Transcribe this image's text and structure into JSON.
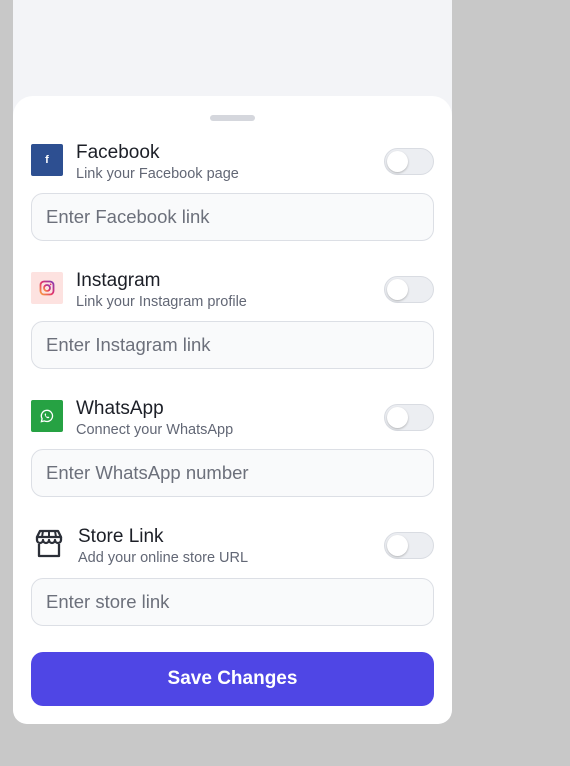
{
  "links": [
    {
      "key": "facebook",
      "title": "Facebook",
      "subtitle": "Link your Facebook page",
      "placeholder": "Enter Facebook link",
      "enabled": false,
      "icon": "facebook-icon",
      "icon_glyph": "f",
      "icon_color": "#2d4f91"
    },
    {
      "key": "instagram",
      "title": "Instagram",
      "subtitle": "Link your Instagram profile",
      "placeholder": "Enter Instagram link",
      "enabled": false,
      "icon": "instagram-icon",
      "icon_color": "#fde2e0"
    },
    {
      "key": "whatsapp",
      "title": "WhatsApp",
      "subtitle": "Connect your WhatsApp",
      "placeholder": "Enter WhatsApp number",
      "enabled": false,
      "icon": "whatsapp-icon",
      "icon_color": "#26a243"
    },
    {
      "key": "store",
      "title": "Store Link",
      "subtitle": "Add your online store URL",
      "placeholder": "Enter store link",
      "enabled": false,
      "icon": "store-icon"
    }
  ],
  "save_button": {
    "label": "Save Changes",
    "color": "#4f46e5"
  }
}
